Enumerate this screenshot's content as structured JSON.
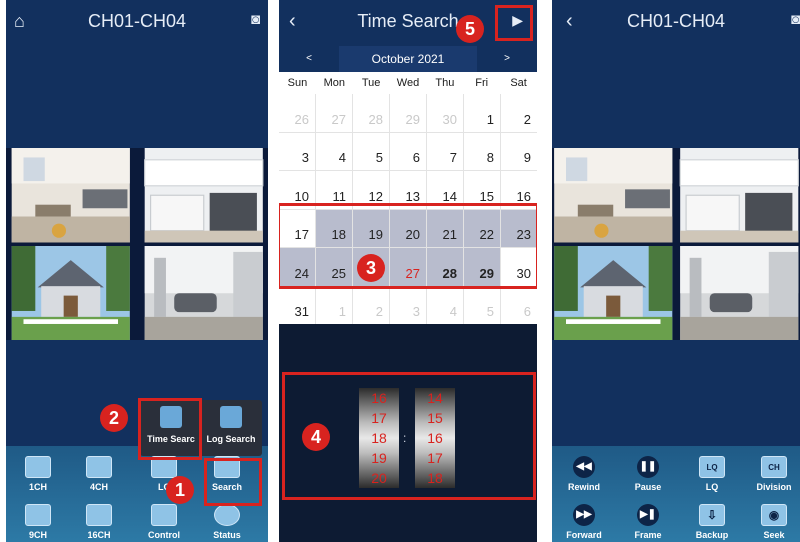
{
  "panel1": {
    "title": "CH01-CH04",
    "home_icon": "home-icon",
    "camera_icon": "camera-icon",
    "buttons": [
      {
        "label": "1CH",
        "icon": "single-channel-icon"
      },
      {
        "label": "4CH",
        "icon": "quad-channel-icon"
      },
      {
        "label": "LC",
        "icon": "live-icon"
      },
      {
        "label": "Search",
        "icon": "search-icon"
      },
      {
        "label": "9CH",
        "icon": "nine-channel-icon"
      },
      {
        "label": "16CH",
        "icon": "sixteen-channel-icon"
      },
      {
        "label": "Control",
        "icon": "control-icon"
      },
      {
        "label": "Status",
        "icon": "status-icon"
      }
    ],
    "popup": [
      {
        "label": "Time Searc",
        "icon": "time-search-icon"
      },
      {
        "label": "Log Search",
        "icon": "log-search-icon"
      }
    ]
  },
  "panel2": {
    "title": "Time Search",
    "back_icon": "back-icon",
    "play_icon": "play-icon",
    "month": "October 2021",
    "prev": "<",
    "next": ">",
    "weekdays": [
      "Sun",
      "Mon",
      "Tue",
      "Wed",
      "Thu",
      "Fri",
      "Sat"
    ],
    "days": [
      {
        "d": "26",
        "t": "other"
      },
      {
        "d": "27",
        "t": "other"
      },
      {
        "d": "28",
        "t": "other"
      },
      {
        "d": "29",
        "t": "other"
      },
      {
        "d": "30",
        "t": "other"
      },
      {
        "d": "1",
        "t": ""
      },
      {
        "d": "2",
        "t": ""
      },
      {
        "d": "3",
        "t": ""
      },
      {
        "d": "4",
        "t": ""
      },
      {
        "d": "5",
        "t": ""
      },
      {
        "d": "6",
        "t": ""
      },
      {
        "d": "7",
        "t": ""
      },
      {
        "d": "8",
        "t": ""
      },
      {
        "d": "9",
        "t": ""
      },
      {
        "d": "10",
        "t": ""
      },
      {
        "d": "11",
        "t": ""
      },
      {
        "d": "12",
        "t": ""
      },
      {
        "d": "13",
        "t": ""
      },
      {
        "d": "14",
        "t": ""
      },
      {
        "d": "15",
        "t": ""
      },
      {
        "d": "16",
        "t": ""
      },
      {
        "d": "17",
        "t": ""
      },
      {
        "d": "18",
        "t": "rec"
      },
      {
        "d": "19",
        "t": "rec"
      },
      {
        "d": "20",
        "t": "rec"
      },
      {
        "d": "21",
        "t": "rec"
      },
      {
        "d": "22",
        "t": "rec"
      },
      {
        "d": "23",
        "t": "rec"
      },
      {
        "d": "24",
        "t": "rec"
      },
      {
        "d": "25",
        "t": "rec"
      },
      {
        "d": "26",
        "t": "rec"
      },
      {
        "d": "27",
        "t": "rec red"
      },
      {
        "d": "28",
        "t": "rec bold"
      },
      {
        "d": "29",
        "t": "rec bold"
      },
      {
        "d": "30",
        "t": ""
      },
      {
        "d": "31",
        "t": ""
      },
      {
        "d": "1",
        "t": "other"
      },
      {
        "d": "2",
        "t": "other"
      },
      {
        "d": "3",
        "t": "other"
      },
      {
        "d": "4",
        "t": "other"
      },
      {
        "d": "5",
        "t": "other"
      },
      {
        "d": "6",
        "t": "other"
      }
    ],
    "hours": [
      "16",
      "17",
      "18",
      "19",
      "20"
    ],
    "minutes": [
      "14",
      "15",
      "16",
      "17",
      "18"
    ],
    "separator": ":"
  },
  "panel3": {
    "title": "CH01-CH04",
    "back_icon": "back-icon",
    "camera_icon": "camera-icon",
    "buttons": [
      {
        "label": "Rewind",
        "icon": "rewind-icon",
        "glyph": "◀◀"
      },
      {
        "label": "Pause",
        "icon": "pause-icon",
        "glyph": "❚❚"
      },
      {
        "label": "LQ",
        "icon": "lq-icon",
        "glyph": "LQ"
      },
      {
        "label": "Division",
        "icon": "division-icon",
        "glyph": "CH"
      },
      {
        "label": "Forward",
        "icon": "forward-icon",
        "glyph": "▶▶"
      },
      {
        "label": "Frame",
        "icon": "frame-icon",
        "glyph": "▶❚"
      },
      {
        "label": "Backup",
        "icon": "backup-icon",
        "glyph": "⇩"
      },
      {
        "label": "Seek",
        "icon": "seek-icon",
        "glyph": "◉"
      }
    ]
  },
  "callouts": [
    "1",
    "2",
    "3",
    "4",
    "5"
  ],
  "colors": {
    "accent_red": "#d8231f",
    "topbar": "#12305e",
    "record_day": "#b8bccd"
  }
}
